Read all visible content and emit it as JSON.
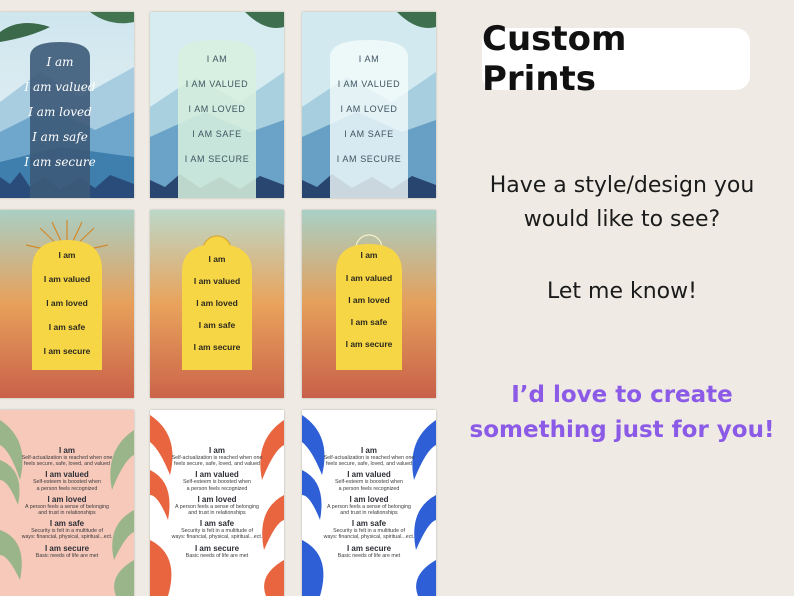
{
  "headline": "Custom Prints",
  "body": {
    "line1": "Have a style/design you",
    "line2": "would like to see?",
    "line3": "Let me know!",
    "cta1": "I’d love to create",
    "cta2": "something just for you!"
  },
  "cards_row1": {
    "script_lines": [
      "I am",
      "I am valued",
      "I am loved",
      "I am safe",
      "I am secure"
    ],
    "caps_lines": [
      "I AM",
      "I AM VALUED",
      "I AM LOVED",
      "I AM SAFE",
      "I AM SECURE"
    ]
  },
  "cards_row2": {
    "lines": [
      "I am",
      "I am valued",
      "I am loved",
      "I am safe",
      "I am secure"
    ]
  },
  "cards_row3": {
    "items": [
      {
        "title": "I am",
        "desc1": "Self-actualization is reached when one",
        "desc2": "feels secure, safe, loved, and valued"
      },
      {
        "title": "I am valued",
        "desc1": "Self-esteem is boosted when",
        "desc2": "a person feels recognized"
      },
      {
        "title": "I am loved",
        "desc1": "A person feels a sense of belonging",
        "desc2": "and trust in relationships"
      },
      {
        "title": "I am safe",
        "desc1": "Security is felt  in a multitude of",
        "desc2": "ways: financial, physical, spiritual...ect."
      },
      {
        "title": "I am secure",
        "desc1": "Basic needs of life are met",
        "desc2": ""
      }
    ]
  },
  "colors": {
    "background": "#efeae4",
    "cta_purple": "#8b5ae6",
    "sunset_top": "#a9cfc4",
    "sunset_mid": "#e7a05a",
    "sunset_bottom": "#c9614a",
    "arch_yellow": "#f7d646",
    "leaf_sage": "#9bb58a",
    "leaf_coral": "#e8653f",
    "leaf_blue": "#2f5fd6",
    "pink_bg": "#f6c9bb"
  }
}
